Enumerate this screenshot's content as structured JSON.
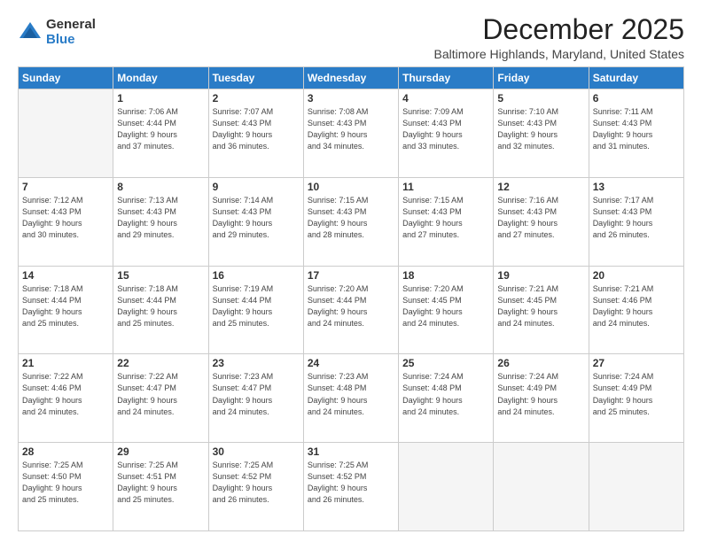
{
  "logo": {
    "general": "General",
    "blue": "Blue"
  },
  "header": {
    "month": "December 2025",
    "location": "Baltimore Highlands, Maryland, United States"
  },
  "weekdays": [
    "Sunday",
    "Monday",
    "Tuesday",
    "Wednesday",
    "Thursday",
    "Friday",
    "Saturday"
  ],
  "weeks": [
    [
      {
        "day": "",
        "info": ""
      },
      {
        "day": "1",
        "info": "Sunrise: 7:06 AM\nSunset: 4:44 PM\nDaylight: 9 hours\nand 37 minutes."
      },
      {
        "day": "2",
        "info": "Sunrise: 7:07 AM\nSunset: 4:43 PM\nDaylight: 9 hours\nand 36 minutes."
      },
      {
        "day": "3",
        "info": "Sunrise: 7:08 AM\nSunset: 4:43 PM\nDaylight: 9 hours\nand 34 minutes."
      },
      {
        "day": "4",
        "info": "Sunrise: 7:09 AM\nSunset: 4:43 PM\nDaylight: 9 hours\nand 33 minutes."
      },
      {
        "day": "5",
        "info": "Sunrise: 7:10 AM\nSunset: 4:43 PM\nDaylight: 9 hours\nand 32 minutes."
      },
      {
        "day": "6",
        "info": "Sunrise: 7:11 AM\nSunset: 4:43 PM\nDaylight: 9 hours\nand 31 minutes."
      }
    ],
    [
      {
        "day": "7",
        "info": "Sunrise: 7:12 AM\nSunset: 4:43 PM\nDaylight: 9 hours\nand 30 minutes."
      },
      {
        "day": "8",
        "info": "Sunrise: 7:13 AM\nSunset: 4:43 PM\nDaylight: 9 hours\nand 29 minutes."
      },
      {
        "day": "9",
        "info": "Sunrise: 7:14 AM\nSunset: 4:43 PM\nDaylight: 9 hours\nand 29 minutes."
      },
      {
        "day": "10",
        "info": "Sunrise: 7:15 AM\nSunset: 4:43 PM\nDaylight: 9 hours\nand 28 minutes."
      },
      {
        "day": "11",
        "info": "Sunrise: 7:15 AM\nSunset: 4:43 PM\nDaylight: 9 hours\nand 27 minutes."
      },
      {
        "day": "12",
        "info": "Sunrise: 7:16 AM\nSunset: 4:43 PM\nDaylight: 9 hours\nand 27 minutes."
      },
      {
        "day": "13",
        "info": "Sunrise: 7:17 AM\nSunset: 4:43 PM\nDaylight: 9 hours\nand 26 minutes."
      }
    ],
    [
      {
        "day": "14",
        "info": "Sunrise: 7:18 AM\nSunset: 4:44 PM\nDaylight: 9 hours\nand 25 minutes."
      },
      {
        "day": "15",
        "info": "Sunrise: 7:18 AM\nSunset: 4:44 PM\nDaylight: 9 hours\nand 25 minutes."
      },
      {
        "day": "16",
        "info": "Sunrise: 7:19 AM\nSunset: 4:44 PM\nDaylight: 9 hours\nand 25 minutes."
      },
      {
        "day": "17",
        "info": "Sunrise: 7:20 AM\nSunset: 4:44 PM\nDaylight: 9 hours\nand 24 minutes."
      },
      {
        "day": "18",
        "info": "Sunrise: 7:20 AM\nSunset: 4:45 PM\nDaylight: 9 hours\nand 24 minutes."
      },
      {
        "day": "19",
        "info": "Sunrise: 7:21 AM\nSunset: 4:45 PM\nDaylight: 9 hours\nand 24 minutes."
      },
      {
        "day": "20",
        "info": "Sunrise: 7:21 AM\nSunset: 4:46 PM\nDaylight: 9 hours\nand 24 minutes."
      }
    ],
    [
      {
        "day": "21",
        "info": "Sunrise: 7:22 AM\nSunset: 4:46 PM\nDaylight: 9 hours\nand 24 minutes."
      },
      {
        "day": "22",
        "info": "Sunrise: 7:22 AM\nSunset: 4:47 PM\nDaylight: 9 hours\nand 24 minutes."
      },
      {
        "day": "23",
        "info": "Sunrise: 7:23 AM\nSunset: 4:47 PM\nDaylight: 9 hours\nand 24 minutes."
      },
      {
        "day": "24",
        "info": "Sunrise: 7:23 AM\nSunset: 4:48 PM\nDaylight: 9 hours\nand 24 minutes."
      },
      {
        "day": "25",
        "info": "Sunrise: 7:24 AM\nSunset: 4:48 PM\nDaylight: 9 hours\nand 24 minutes."
      },
      {
        "day": "26",
        "info": "Sunrise: 7:24 AM\nSunset: 4:49 PM\nDaylight: 9 hours\nand 24 minutes."
      },
      {
        "day": "27",
        "info": "Sunrise: 7:24 AM\nSunset: 4:49 PM\nDaylight: 9 hours\nand 25 minutes."
      }
    ],
    [
      {
        "day": "28",
        "info": "Sunrise: 7:25 AM\nSunset: 4:50 PM\nDaylight: 9 hours\nand 25 minutes."
      },
      {
        "day": "29",
        "info": "Sunrise: 7:25 AM\nSunset: 4:51 PM\nDaylight: 9 hours\nand 25 minutes."
      },
      {
        "day": "30",
        "info": "Sunrise: 7:25 AM\nSunset: 4:52 PM\nDaylight: 9 hours\nand 26 minutes."
      },
      {
        "day": "31",
        "info": "Sunrise: 7:25 AM\nSunset: 4:52 PM\nDaylight: 9 hours\nand 26 minutes."
      },
      {
        "day": "",
        "info": ""
      },
      {
        "day": "",
        "info": ""
      },
      {
        "day": "",
        "info": ""
      }
    ]
  ]
}
